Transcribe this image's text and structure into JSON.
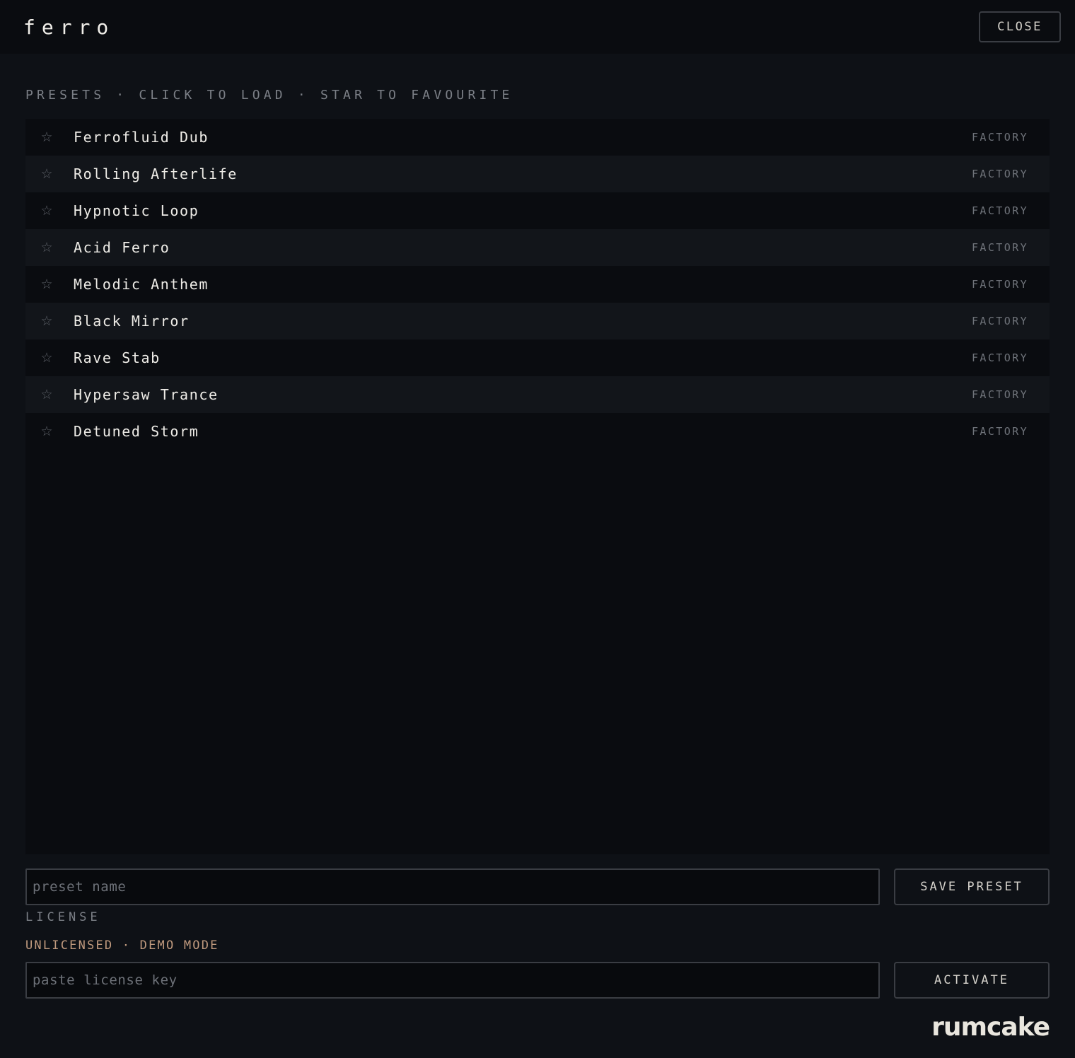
{
  "app": {
    "logo": "ferro",
    "close_label": "CLOSE"
  },
  "presets": {
    "title": "PRESETS · CLICK TO LOAD · STAR TO FAVOURITE",
    "items": [
      {
        "name": "Ferrofluid Dub",
        "tag": "FACTORY",
        "star": "☆"
      },
      {
        "name": "Rolling Afterlife",
        "tag": "FACTORY",
        "star": "☆"
      },
      {
        "name": "Hypnotic Loop",
        "tag": "FACTORY",
        "star": "☆"
      },
      {
        "name": "Acid Ferro",
        "tag": "FACTORY",
        "star": "☆"
      },
      {
        "name": "Melodic Anthem",
        "tag": "FACTORY",
        "star": "☆"
      },
      {
        "name": "Black Mirror",
        "tag": "FACTORY",
        "star": "☆"
      },
      {
        "name": "Rave Stab",
        "tag": "FACTORY",
        "star": "☆"
      },
      {
        "name": "Hypersaw Trance",
        "tag": "FACTORY",
        "star": "☆"
      },
      {
        "name": "Detuned Storm",
        "tag": "FACTORY",
        "star": "☆"
      }
    ]
  },
  "save": {
    "placeholder": "preset name",
    "value": "",
    "button_label": "SAVE PRESET"
  },
  "license": {
    "label": "LICENSE",
    "status": "UNLICENSED · DEMO MODE",
    "placeholder": "paste license key",
    "value": "",
    "button_label": "ACTIVATE"
  },
  "brand": "rumcake",
  "colors": {
    "background": "#0e1116",
    "panel": "#0a0c10",
    "row_alt": "#12151a",
    "status_accent": "#c09a7e",
    "border": "#3a3d43"
  },
  "icons": {
    "star": "star-outline-icon"
  }
}
